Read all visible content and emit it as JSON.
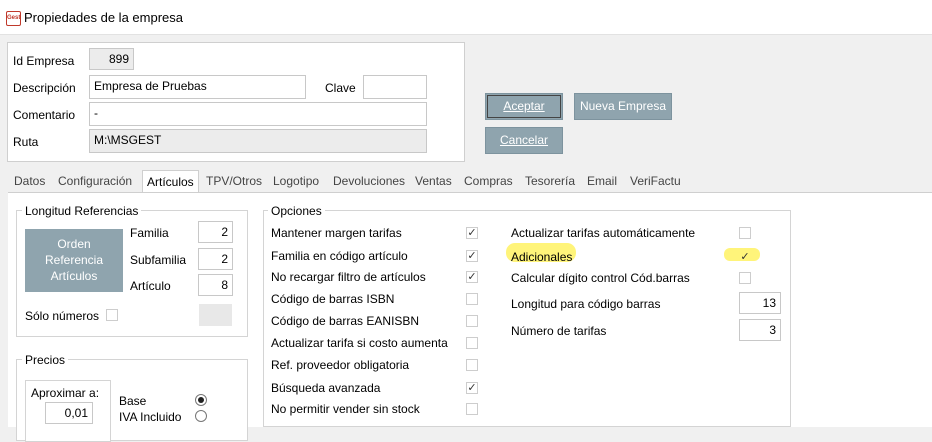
{
  "window": {
    "title": "Propiedades de la empresa",
    "icon_text": "Gest"
  },
  "header": {
    "id_empresa": {
      "label": "Id Empresa",
      "value": "899"
    },
    "descripcion": {
      "label": "Descripción",
      "value": "Empresa de Pruebas"
    },
    "clave": {
      "label": "Clave",
      "value": ""
    },
    "comentario": {
      "label": "Comentario",
      "value": "-"
    },
    "ruta": {
      "label": "Ruta",
      "value": "M:\\MSGEST"
    }
  },
  "buttons": {
    "aceptar": "Aceptar",
    "nueva_empresa": "Nueva Empresa",
    "cancelar": "Cancelar"
  },
  "tabs": [
    "Datos",
    "Configuración",
    "Artículos",
    "TPV/Otros",
    "Logotipo",
    "Devoluciones",
    "Ventas",
    "Compras",
    "Tesorería",
    "Email",
    "VeriFactu"
  ],
  "active_tab": "Artículos",
  "longitud": {
    "title": "Longitud Referencias",
    "orden_button": [
      "Orden",
      "Referencia",
      "Artículos"
    ],
    "familia": {
      "label": "Familia",
      "value": "2"
    },
    "subfamilia": {
      "label": "Subfamilia",
      "value": "2"
    },
    "articulo": {
      "label": "Artículo",
      "value": "8"
    },
    "solo_numeros": {
      "label": "Sólo números",
      "checked": false
    }
  },
  "precios": {
    "title": "Precios",
    "aproximar": {
      "label": "Aproximar a:",
      "value": "0,01"
    },
    "base": {
      "label": "Base",
      "selected": true
    },
    "iva": {
      "label": "IVA Incluido",
      "selected": false
    }
  },
  "opciones": {
    "title": "Opciones",
    "left": [
      {
        "label": "Mantener margen tarifas",
        "checked": true
      },
      {
        "label": "Familia en código artículo",
        "checked": true
      },
      {
        "label": "No recargar filtro de artículos",
        "checked": true
      },
      {
        "label": "Código de barras ISBN",
        "checked": false
      },
      {
        "label": "Código de barras EANISBN",
        "checked": false
      },
      {
        "label": "Actualizar tarifa si costo aumenta",
        "checked": false
      },
      {
        "label": "Ref. proveedor obligatoria",
        "checked": false
      },
      {
        "label": "Búsqueda avanzada",
        "checked": true
      },
      {
        "label": "No permitir vender sin stock",
        "checked": false
      }
    ],
    "right": [
      {
        "label": "Actualizar tarifas automáticamente",
        "checked": false
      },
      {
        "label": "Adicionales",
        "checked": true
      },
      {
        "label": "Calcular dígito control Cód.barras",
        "checked": false
      }
    ],
    "longitud_codigo": {
      "label": "Longitud para código barras",
      "value": "13"
    },
    "numero_tarifas": {
      "label": "Número de tarifas",
      "value": "3"
    }
  },
  "colors": {
    "button": "#8fa4ae",
    "highlight": "#fff47a"
  }
}
